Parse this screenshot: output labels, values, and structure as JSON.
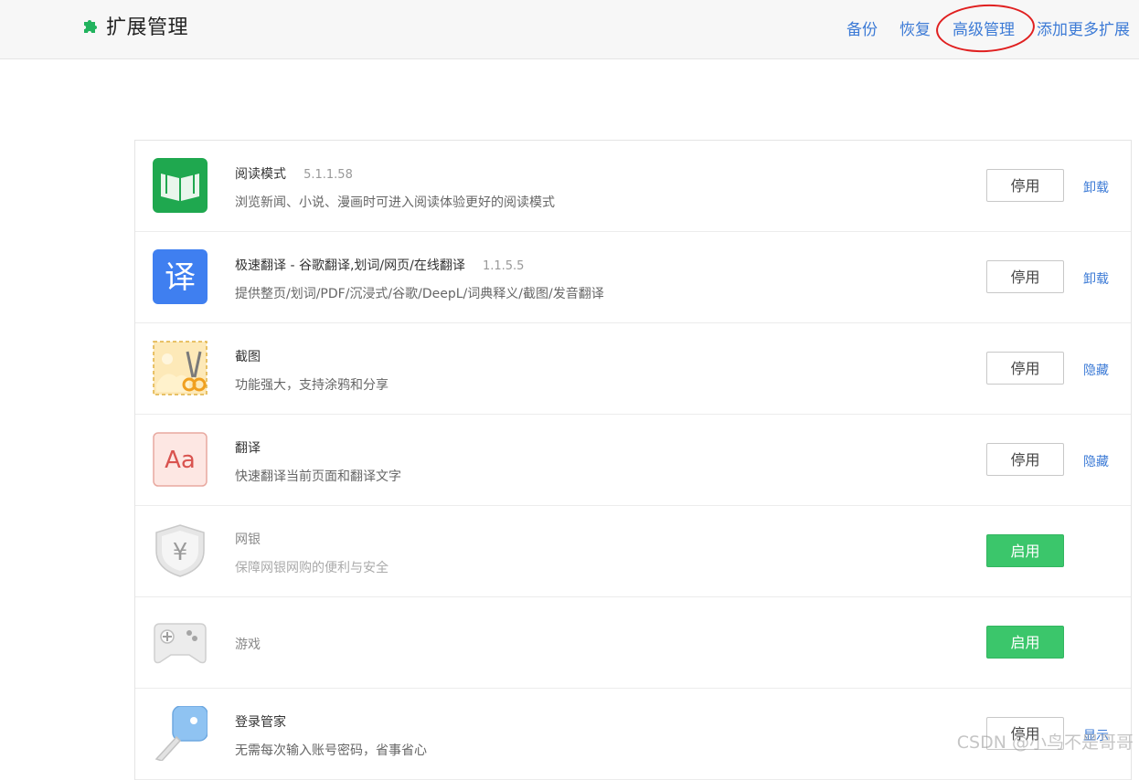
{
  "header": {
    "title": "扩展管理",
    "nav": [
      "备份",
      "恢复",
      "高级管理",
      "添加更多扩展"
    ]
  },
  "extensions": [
    {
      "name": "阅读模式",
      "version": "5.1.1.58",
      "desc": "浏览新闻、小说、漫画时可进入阅读体验更好的阅读模式",
      "button": "停用",
      "link": "卸载"
    },
    {
      "name": "极速翻译 - 谷歌翻译,划词/网页/在线翻译",
      "version": "1.1.5.5",
      "desc": "提供整页/划词/PDF/沉浸式/谷歌/DeepL/词典释义/截图/发音翻译",
      "button": "停用",
      "link": "卸载"
    },
    {
      "name": "截图",
      "desc": "功能强大，支持涂鸦和分享",
      "button": "停用",
      "link": "隐藏"
    },
    {
      "name": "翻译",
      "desc": "快速翻译当前页面和翻译文字",
      "button": "停用",
      "link": "隐藏"
    },
    {
      "name": "网银",
      "desc": "保障网银网购的便利与安全",
      "button": "启用"
    },
    {
      "name": "游戏",
      "button": "启用"
    },
    {
      "name": "登录管家",
      "desc": "无需每次输入账号密码，省事省心",
      "button": "停用",
      "link": "显示"
    }
  ],
  "icons": {
    "translate_glyph": "译",
    "font_glyph": "Aa",
    "yen_glyph": "¥"
  },
  "watermark": "CSDN @小鸟不是哥哥"
}
